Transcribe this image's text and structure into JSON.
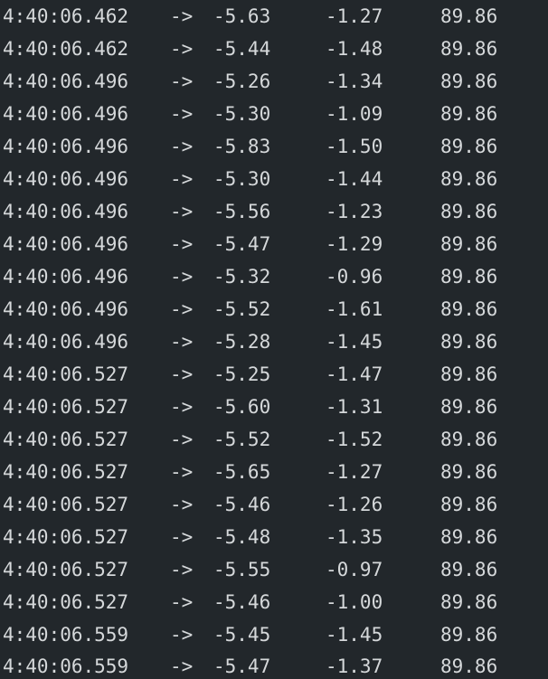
{
  "console": {
    "rows": [
      {
        "time": "4:40:06.462",
        "arrow": "->",
        "a": "-5.63",
        "b": "-1.27",
        "c": "89.86"
      },
      {
        "time": "4:40:06.462",
        "arrow": "->",
        "a": "-5.44",
        "b": "-1.48",
        "c": "89.86"
      },
      {
        "time": "4:40:06.496",
        "arrow": "->",
        "a": "-5.26",
        "b": "-1.34",
        "c": "89.86"
      },
      {
        "time": "4:40:06.496",
        "arrow": "->",
        "a": "-5.30",
        "b": "-1.09",
        "c": "89.86"
      },
      {
        "time": "4:40:06.496",
        "arrow": "->",
        "a": "-5.83",
        "b": "-1.50",
        "c": "89.86"
      },
      {
        "time": "4:40:06.496",
        "arrow": "->",
        "a": "-5.30",
        "b": "-1.44",
        "c": "89.86"
      },
      {
        "time": "4:40:06.496",
        "arrow": "->",
        "a": "-5.56",
        "b": "-1.23",
        "c": "89.86"
      },
      {
        "time": "4:40:06.496",
        "arrow": "->",
        "a": "-5.47",
        "b": "-1.29",
        "c": "89.86"
      },
      {
        "time": "4:40:06.496",
        "arrow": "->",
        "a": "-5.32",
        "b": "-0.96",
        "c": "89.86"
      },
      {
        "time": "4:40:06.496",
        "arrow": "->",
        "a": "-5.52",
        "b": "-1.61",
        "c": "89.86"
      },
      {
        "time": "4:40:06.496",
        "arrow": "->",
        "a": "-5.28",
        "b": "-1.45",
        "c": "89.86"
      },
      {
        "time": "4:40:06.527",
        "arrow": "->",
        "a": "-5.25",
        "b": "-1.47",
        "c": "89.86"
      },
      {
        "time": "4:40:06.527",
        "arrow": "->",
        "a": "-5.60",
        "b": "-1.31",
        "c": "89.86"
      },
      {
        "time": "4:40:06.527",
        "arrow": "->",
        "a": "-5.52",
        "b": "-1.52",
        "c": "89.86"
      },
      {
        "time": "4:40:06.527",
        "arrow": "->",
        "a": "-5.65",
        "b": "-1.27",
        "c": "89.86"
      },
      {
        "time": "4:40:06.527",
        "arrow": "->",
        "a": "-5.46",
        "b": "-1.26",
        "c": "89.86"
      },
      {
        "time": "4:40:06.527",
        "arrow": "->",
        "a": "-5.48",
        "b": "-1.35",
        "c": "89.86"
      },
      {
        "time": "4:40:06.527",
        "arrow": "->",
        "a": "-5.55",
        "b": "-0.97",
        "c": "89.86"
      },
      {
        "time": "4:40:06.527",
        "arrow": "->",
        "a": "-5.46",
        "b": "-1.00",
        "c": "89.86"
      },
      {
        "time": "4:40:06.559",
        "arrow": "->",
        "a": "-5.45",
        "b": "-1.45",
        "c": "89.86"
      },
      {
        "time": "4:40:06.559",
        "arrow": "->",
        "a": "-5.47",
        "b": "-1.37",
        "c": "89.86"
      }
    ]
  }
}
